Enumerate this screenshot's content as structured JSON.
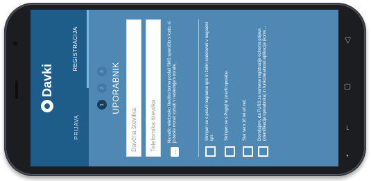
{
  "app": {
    "logo_text": "Davki"
  },
  "tabs": [
    {
      "label": "PRIJAVA",
      "active": false
    },
    {
      "label": "REGISTRACIJA",
      "active": true
    }
  ],
  "steps": [
    "1",
    "2",
    "3"
  ],
  "heading": "UPORABNIK",
  "fields": {
    "tax_placeholder": "Davčna številka",
    "phone_placeholder": "Telefonska številka"
  },
  "info_text": "Na vašo telefonsko številko bomo poslali SMS sporočilo s kodo, ki jo boste morali vpisati v naslednjem koraku.",
  "checkboxes": [
    {
      "text": "Strinjam se s pravili nagradne igre in želim sodelovati v nagradni igri."
    },
    {
      "text": "Strinjam se s Pogoji in pravili uporabe."
    },
    {
      "text": "Star sem 16 let ali več."
    },
    {
      "text": "Dovoljujem, da FURS za namene registracije oziroma prijave (identifikacije uporabnika) in funkcionalnosti aplikacije (komu..."
    }
  ],
  "nav": {
    "back_icon": "back-icon",
    "home_icon": "home-icon",
    "recent_icon": "recent-apps-icon"
  },
  "colors": {
    "header": "#1e5d8a",
    "screen": "#4f88b3",
    "accent": "#79b6e6"
  }
}
